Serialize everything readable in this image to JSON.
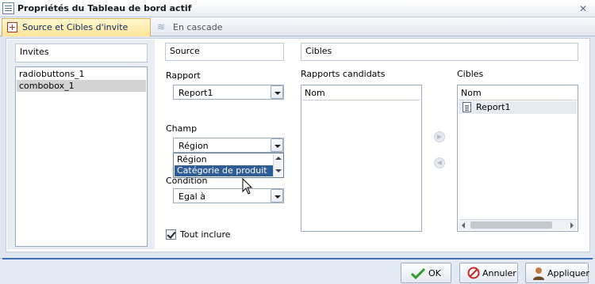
{
  "window": {
    "title": "Propriétés du Tableau de bord actif",
    "close_symbol": "✕"
  },
  "tabs": [
    {
      "label": "Source et Cibles d'invite",
      "active": true
    },
    {
      "label": "En cascade",
      "active": false
    }
  ],
  "prompts": {
    "header": "Invites",
    "items": [
      {
        "label": "radiobuttons_1",
        "selected": false
      },
      {
        "label": "combobox_1",
        "selected": true
      }
    ]
  },
  "source": {
    "header": "Source",
    "report_label": "Rapport",
    "report_value": "Report1",
    "field_label": "Champ",
    "field_value": "Région",
    "field_options": [
      {
        "label": "Région",
        "selected": false
      },
      {
        "label": "Catégorie de produit",
        "selected": true
      }
    ],
    "condition_label": "Condition",
    "condition_value": "Egal à",
    "include_all_label": "Tout inclure",
    "include_all_checked": true
  },
  "targets": {
    "header": "Cibles",
    "candidates_label": "Rapports candidats",
    "candidates_column": "Nom",
    "candidates_rows": [],
    "targets_label": "Cibles",
    "targets_column": "Nom",
    "targets_rows": [
      "Report1"
    ]
  },
  "footer": {
    "ok_label": "OK",
    "cancel_label": "Annuler",
    "apply_label": "Appliquer"
  },
  "colors": {
    "active_tab": "#ffe596",
    "selection_blue": "#2f5d96",
    "accent_line": "#3c6db6",
    "ok_icon": "#2e9b2e",
    "cancel_icon": "#c62828"
  },
  "icons": {
    "move_right": "move-right-icon",
    "move_left": "move-left-icon"
  }
}
